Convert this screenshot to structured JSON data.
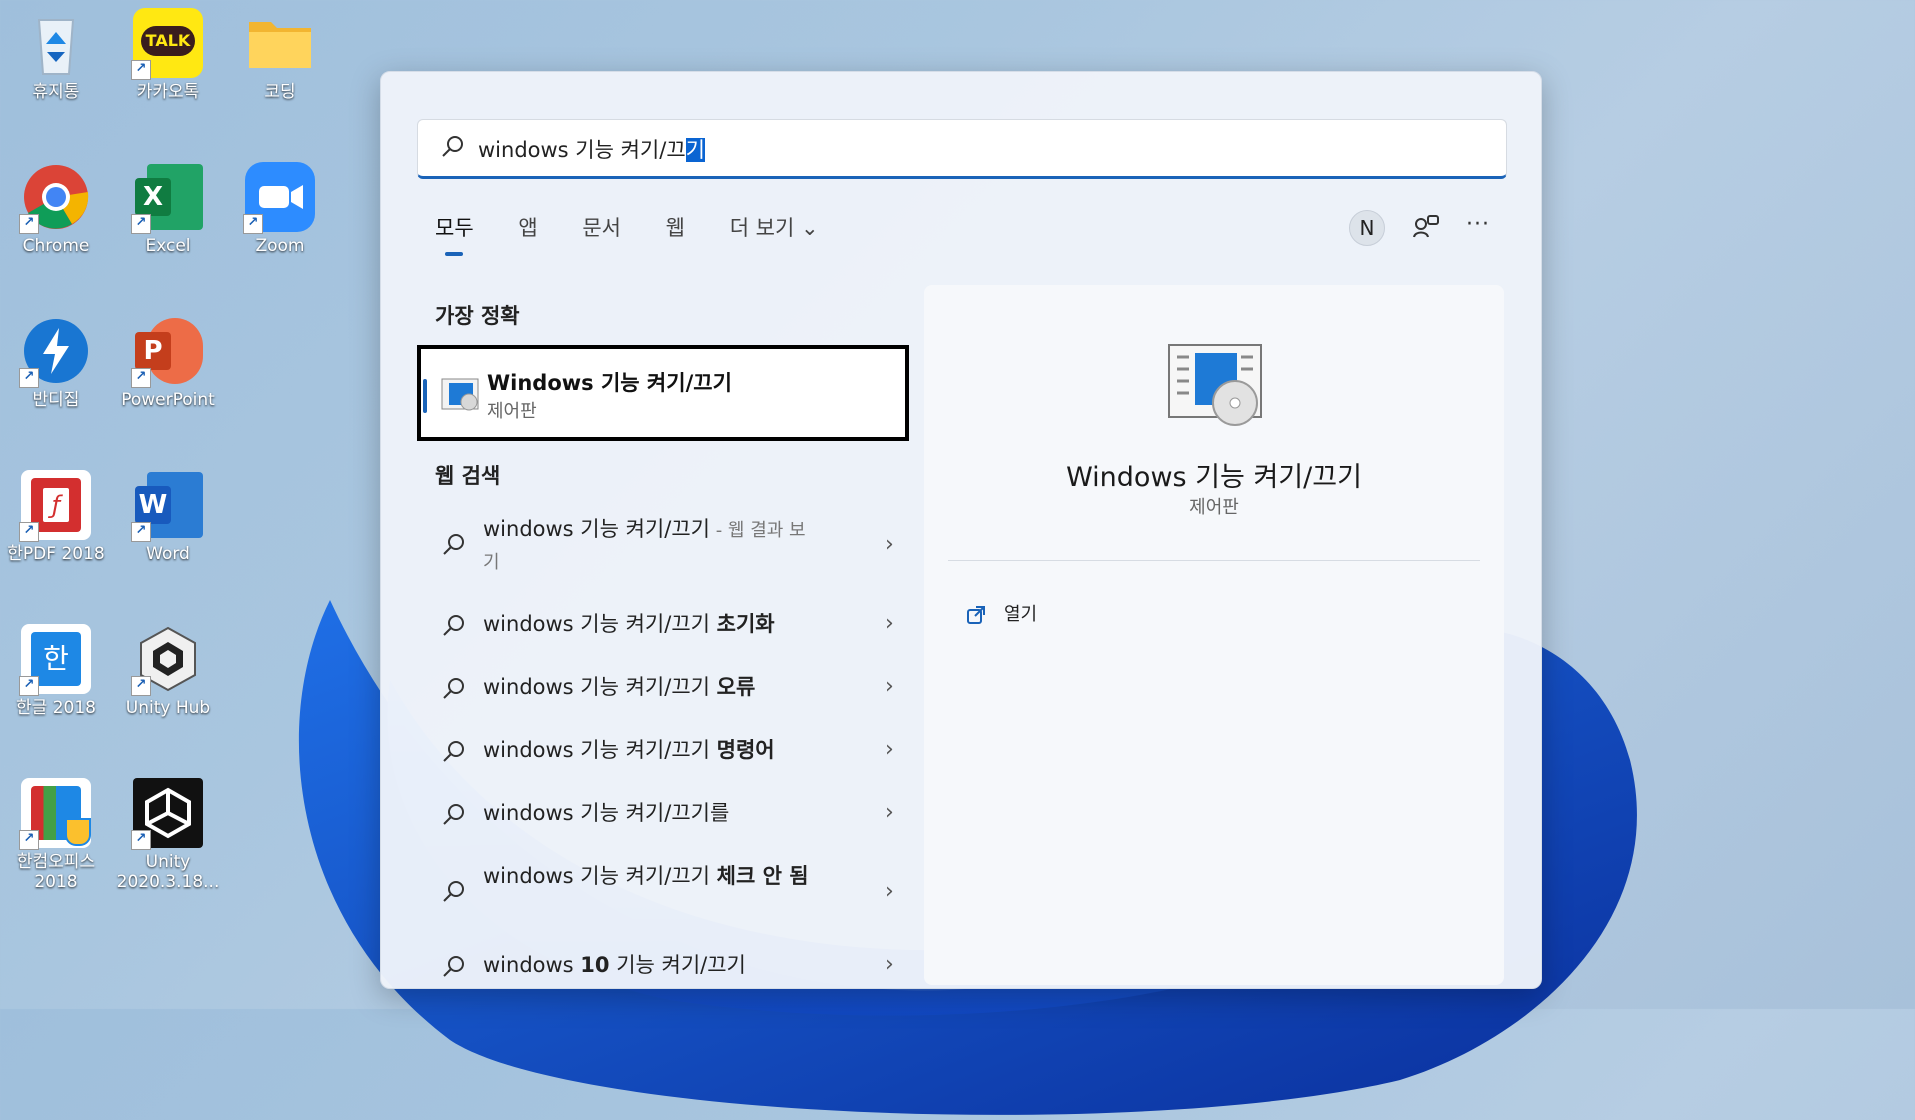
{
  "desktop": {
    "icons": [
      {
        "label": "휴지통",
        "icon": "recycle-bin-icon"
      },
      {
        "label": "카카오톡",
        "icon": "kakaotalk-icon"
      },
      {
        "label": "코딩",
        "icon": "folder-icon"
      },
      {
        "label": "Chrome",
        "icon": "chrome-icon"
      },
      {
        "label": "Excel",
        "icon": "excel-icon"
      },
      {
        "label": "Zoom",
        "icon": "zoom-icon"
      },
      {
        "label": "반디집",
        "icon": "bandizip-icon"
      },
      {
        "label": "PowerPoint",
        "icon": "powerpoint-icon"
      },
      {
        "label": "한PDF 2018",
        "icon": "hanpdf-icon"
      },
      {
        "label": "Word",
        "icon": "word-icon"
      },
      {
        "label": "한글 2018",
        "icon": "hangul-icon"
      },
      {
        "label": "Unity Hub",
        "icon": "unity-hub-icon"
      },
      {
        "label": "한컴오피스 2018",
        "icon": "hancom-office-icon"
      },
      {
        "label": "Unity 2020.3.18...",
        "icon": "unity-icon"
      }
    ],
    "kakao_badge": "TALK",
    "excel_letter": "X",
    "ppt_letter": "P",
    "word_letter": "W",
    "hangul_letter": "한"
  },
  "search": {
    "query_main": "windows 기능 켜기/끄",
    "query_selected": "기"
  },
  "tabs": [
    {
      "label": "모두"
    },
    {
      "label": "앱"
    },
    {
      "label": "문서"
    },
    {
      "label": "웹"
    },
    {
      "label": "더 보기 ⌄"
    }
  ],
  "account_initial": "N",
  "more_label": "···",
  "best_match": {
    "heading": "가장 정확",
    "title": "Windows 기능 켜기/끄기",
    "subtitle": "제어판"
  },
  "web_search": {
    "heading": "웹 검색",
    "items": [
      {
        "prefix": "windows 기능 켜기/끄기",
        "bold": "",
        "suffix": " - 웹 결과 보기"
      },
      {
        "prefix": "windows 기능 켜기/끄기 ",
        "bold": "초기화",
        "suffix": ""
      },
      {
        "prefix": "windows 기능 켜기/끄기 ",
        "bold": "오류",
        "suffix": ""
      },
      {
        "prefix": "windows 기능 켜기/끄기 ",
        "bold": "명령어",
        "suffix": ""
      },
      {
        "prefix": "windows 기능 켜기/끄기를",
        "bold": "",
        "suffix": ""
      },
      {
        "prefix": "windows 기능 켜기/끄기 ",
        "bold": "체크 안 됨",
        "suffix": ""
      },
      {
        "prefix": "windows ",
        "bold": "10",
        "suffix": " 기능 켜기/끄기"
      }
    ]
  },
  "preview": {
    "title": "Windows 기능 켜기/끄기",
    "subtitle": "제어판",
    "open_label": "열기"
  },
  "colors": {
    "accent": "#1a63b8",
    "selection": "#0a64d2"
  }
}
